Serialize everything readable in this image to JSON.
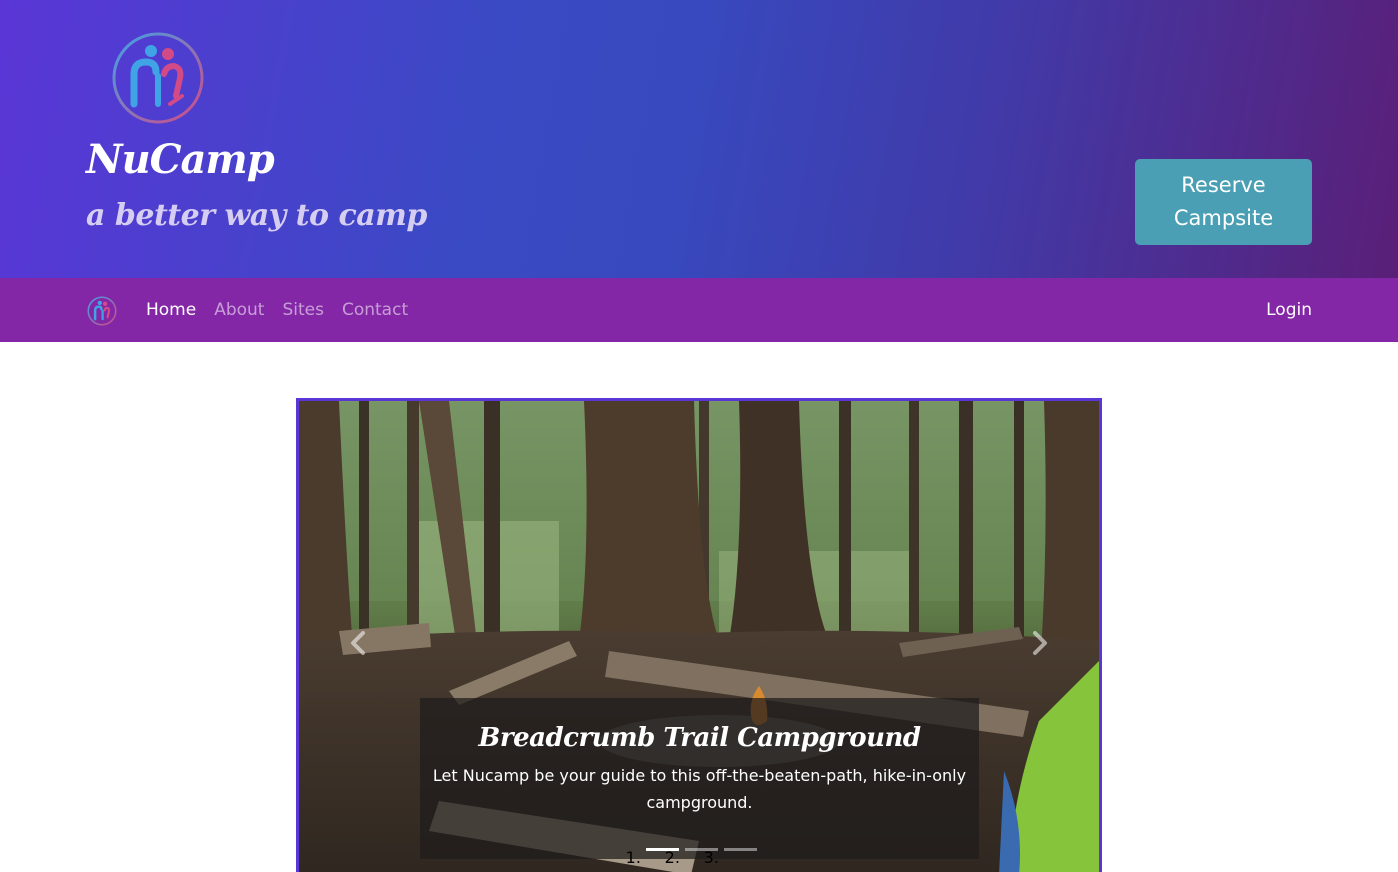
{
  "header": {
    "logo": "nucamp-logo",
    "brand": "NuCamp",
    "tagline": "a better way to camp",
    "reserve_button": "Reserve\nCampsite"
  },
  "navbar": {
    "logo": "nucamp-logo",
    "links": [
      {
        "label": "Home",
        "active": true
      },
      {
        "label": "About",
        "active": false
      },
      {
        "label": "Sites",
        "active": false
      },
      {
        "label": "Contact",
        "active": false
      }
    ],
    "login": "Login"
  },
  "carousel": {
    "slide_count": 3,
    "active_slide": 0,
    "caption_title": "Breadcrumb Trail Campground",
    "caption_text": "Let Nucamp be your guide to this off-the-beaten-path, hike-in-only campground.",
    "prev_icon": "chevron-left-icon",
    "next_icon": "chevron-right-icon"
  },
  "colors": {
    "header_gradient_start": "#5a36d6",
    "header_gradient_mid": "#3848bd",
    "header_gradient_end": "#5a1f78",
    "navbar": "#8427a6",
    "reserve_button": "#4a9fb4",
    "carousel_border": "#5a36d6"
  }
}
